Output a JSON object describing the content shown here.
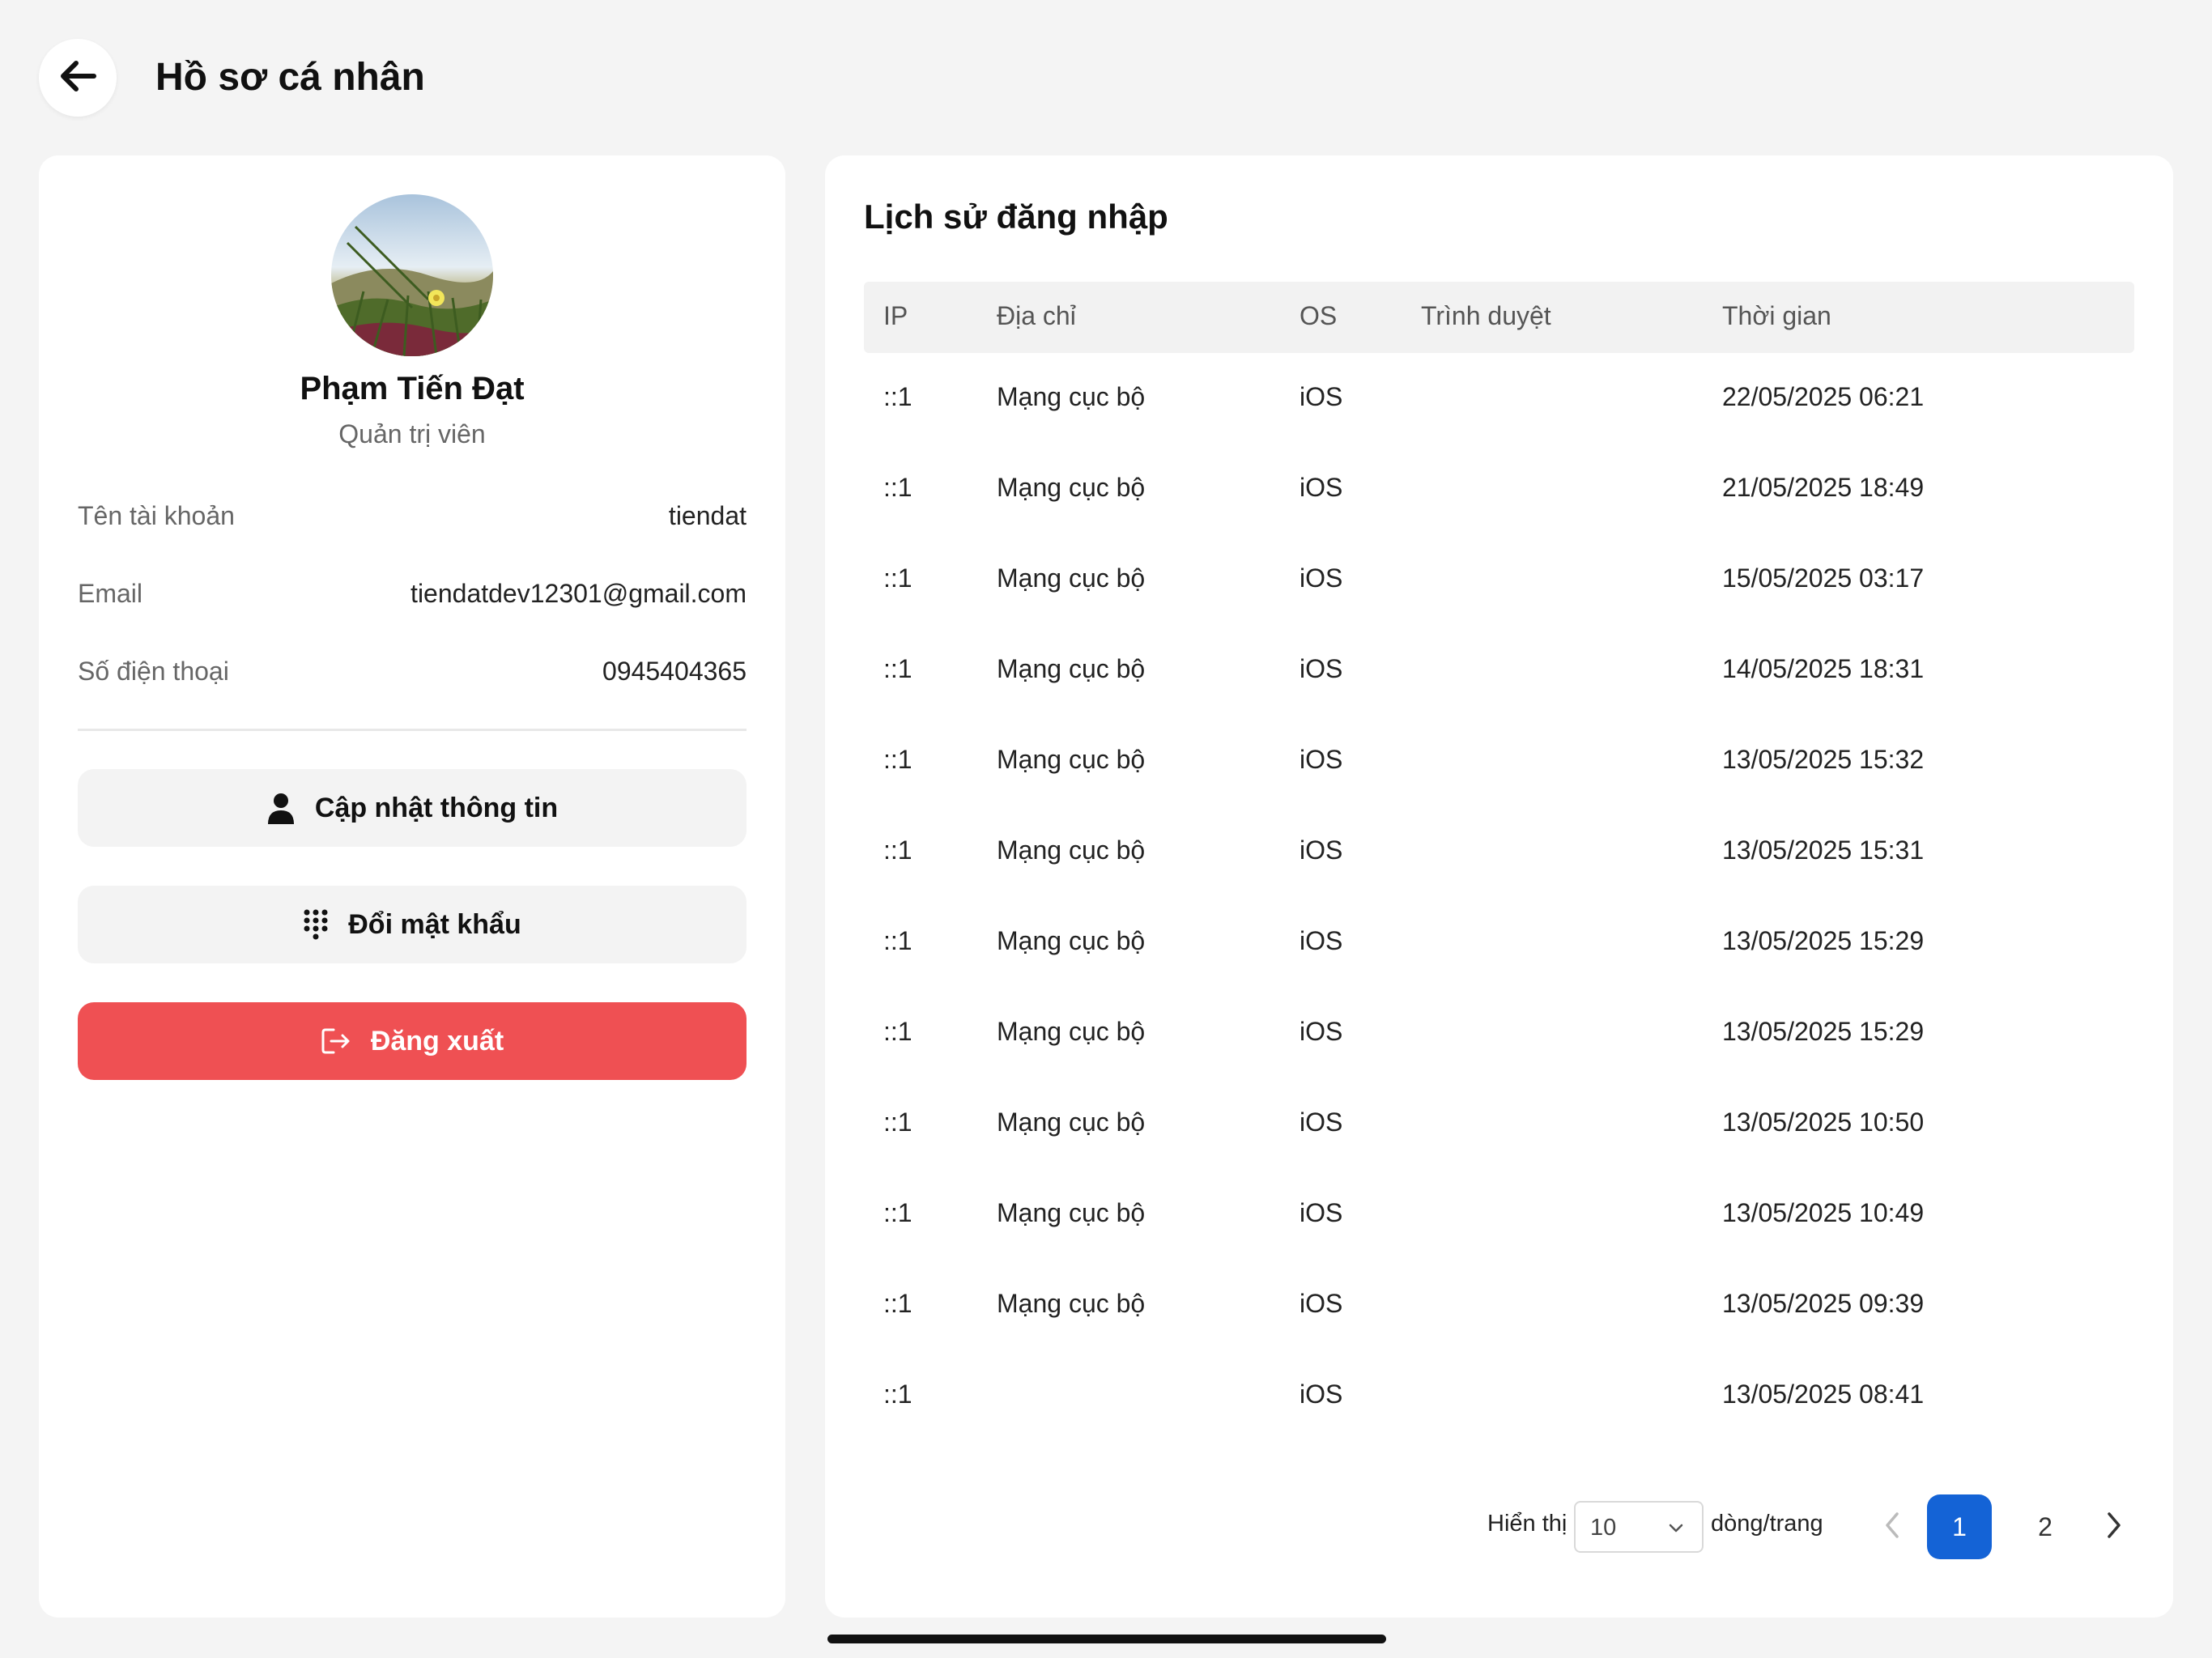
{
  "header": {
    "title": "Hồ sơ cá nhân"
  },
  "profile": {
    "name": "Phạm Tiến Đạt",
    "role": "Quản trị viên",
    "fields": [
      {
        "label": "Tên tài khoản",
        "value": "tiendat"
      },
      {
        "label": "Email",
        "value": "tiendatdev12301@gmail.com"
      },
      {
        "label": "Số điện thoại",
        "value": "0945404365"
      }
    ],
    "actions": {
      "update_label": "Cập nhật thông tin",
      "change_password_label": "Đổi mật khẩu",
      "logout_label": "Đăng xuất"
    }
  },
  "history": {
    "title": "Lịch sử đăng nhập",
    "columns": {
      "ip": "IP",
      "address": "Địa chỉ",
      "os": "OS",
      "browser": "Trình duyệt",
      "time": "Thời gian"
    },
    "rows": [
      {
        "ip": "::1",
        "address": "Mạng cục bộ",
        "os": "iOS",
        "browser": "",
        "time": "22/05/2025 06:21"
      },
      {
        "ip": "::1",
        "address": "Mạng cục bộ",
        "os": "iOS",
        "browser": "",
        "time": "21/05/2025 18:49"
      },
      {
        "ip": "::1",
        "address": "Mạng cục bộ",
        "os": "iOS",
        "browser": "",
        "time": "15/05/2025 03:17"
      },
      {
        "ip": "::1",
        "address": "Mạng cục bộ",
        "os": "iOS",
        "browser": "",
        "time": "14/05/2025 18:31"
      },
      {
        "ip": "::1",
        "address": "Mạng cục bộ",
        "os": "iOS",
        "browser": "",
        "time": "13/05/2025 15:32"
      },
      {
        "ip": "::1",
        "address": "Mạng cục bộ",
        "os": "iOS",
        "browser": "",
        "time": "13/05/2025 15:31"
      },
      {
        "ip": "::1",
        "address": "Mạng cục bộ",
        "os": "iOS",
        "browser": "",
        "time": "13/05/2025 15:29"
      },
      {
        "ip": "::1",
        "address": "Mạng cục bộ",
        "os": "iOS",
        "browser": "",
        "time": "13/05/2025 15:29"
      },
      {
        "ip": "::1",
        "address": "Mạng cục bộ",
        "os": "iOS",
        "browser": "",
        "time": "13/05/2025 10:50"
      },
      {
        "ip": "::1",
        "address": "Mạng cục bộ",
        "os": "iOS",
        "browser": "",
        "time": "13/05/2025 10:49"
      },
      {
        "ip": "::1",
        "address": "Mạng cục bộ",
        "os": "iOS",
        "browser": "",
        "time": "13/05/2025 09:39"
      },
      {
        "ip": "::1",
        "address": "",
        "os": "iOS",
        "browser": "",
        "time": "13/05/2025 08:41"
      }
    ],
    "pagination": {
      "show_label": "Hiển thị",
      "page_size": "10",
      "per_page_label": "dòng/trang",
      "pages": [
        "1",
        "2"
      ],
      "current_page": "1"
    }
  },
  "colors": {
    "danger": "#ef5053",
    "primary": "#1463d6",
    "background": "#f4f4f4"
  },
  "icons": {
    "back": "arrow-left-icon",
    "update": "user-icon",
    "password": "keypad-icon",
    "logout": "logout-icon",
    "prev": "chevron-left-icon",
    "next": "chevron-right-icon",
    "select": "chevron-down-icon"
  }
}
